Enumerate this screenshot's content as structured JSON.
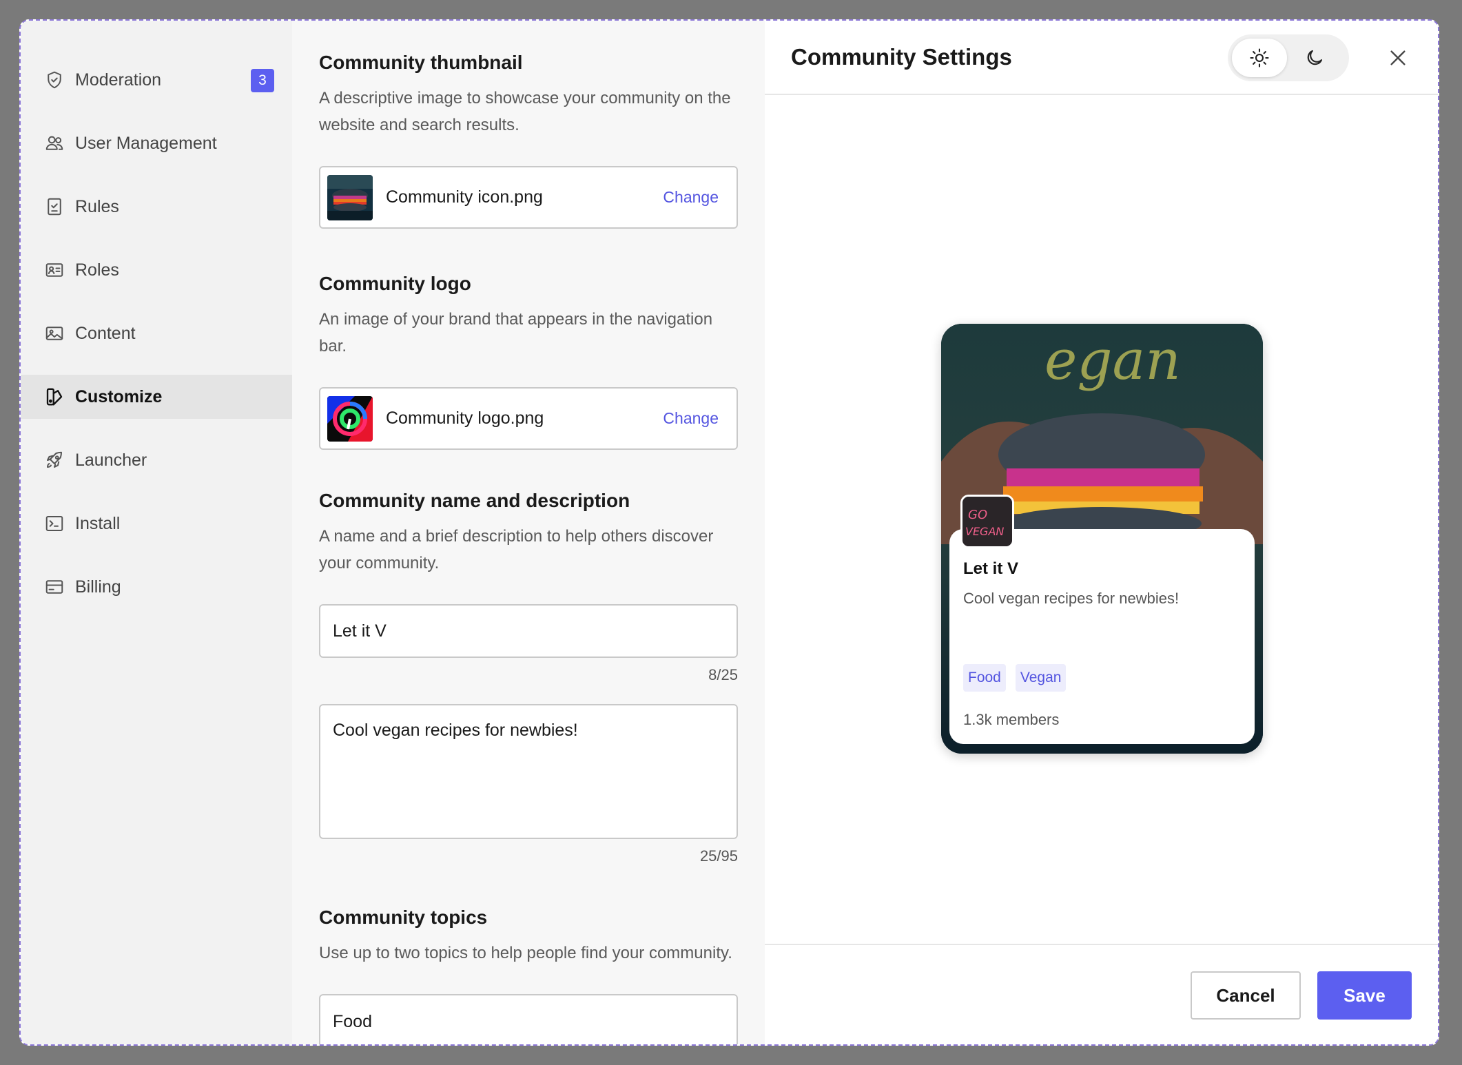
{
  "sidebar": {
    "items": [
      {
        "label": "Moderation",
        "icon": "shield-check-icon",
        "badge": "3"
      },
      {
        "label": "User Management",
        "icon": "users-icon"
      },
      {
        "label": "Rules",
        "icon": "clipboard-check-icon"
      },
      {
        "label": "Roles",
        "icon": "id-card-icon"
      },
      {
        "label": "Content",
        "icon": "image-icon"
      },
      {
        "label": "Customize",
        "icon": "palette-icon",
        "active": true
      },
      {
        "label": "Launcher",
        "icon": "rocket-icon"
      },
      {
        "label": "Install",
        "icon": "terminal-icon"
      },
      {
        "label": "Billing",
        "icon": "credit-card-icon"
      }
    ]
  },
  "form": {
    "thumbnail": {
      "title": "Community thumbnail",
      "description": "A descriptive image to showcase your community on the website and search results.",
      "file_name": "Community icon.png",
      "change_label": "Change"
    },
    "logo": {
      "title": "Community logo",
      "description": "An image of your brand that appears in the navigation bar.",
      "file_name": "Community logo.png",
      "change_label": "Change"
    },
    "name_desc": {
      "title": "Community name and description",
      "description": "A name and a brief description to help others discover your community.",
      "name_value": "Let it V",
      "name_counter": "8/25",
      "desc_value": "Cool vegan recipes for newbies!",
      "desc_counter": "25/95"
    },
    "topics": {
      "title": "Community topics",
      "description": "Use up to two topics to help people find your community.",
      "topic_value": "Food"
    }
  },
  "preview": {
    "title": "Community Settings",
    "theme": "light",
    "card": {
      "name": "Let it V",
      "description": "Cool vegan recipes for newbies!",
      "tags": [
        "Food",
        "Vegan"
      ],
      "members": "1.3k members",
      "avatar_text": "GO VEGAN"
    }
  },
  "footer": {
    "cancel_label": "Cancel",
    "save_label": "Save"
  },
  "colors": {
    "accent": "#5c5ff0",
    "link": "#5354e0",
    "tag_bg": "#ededfc"
  }
}
